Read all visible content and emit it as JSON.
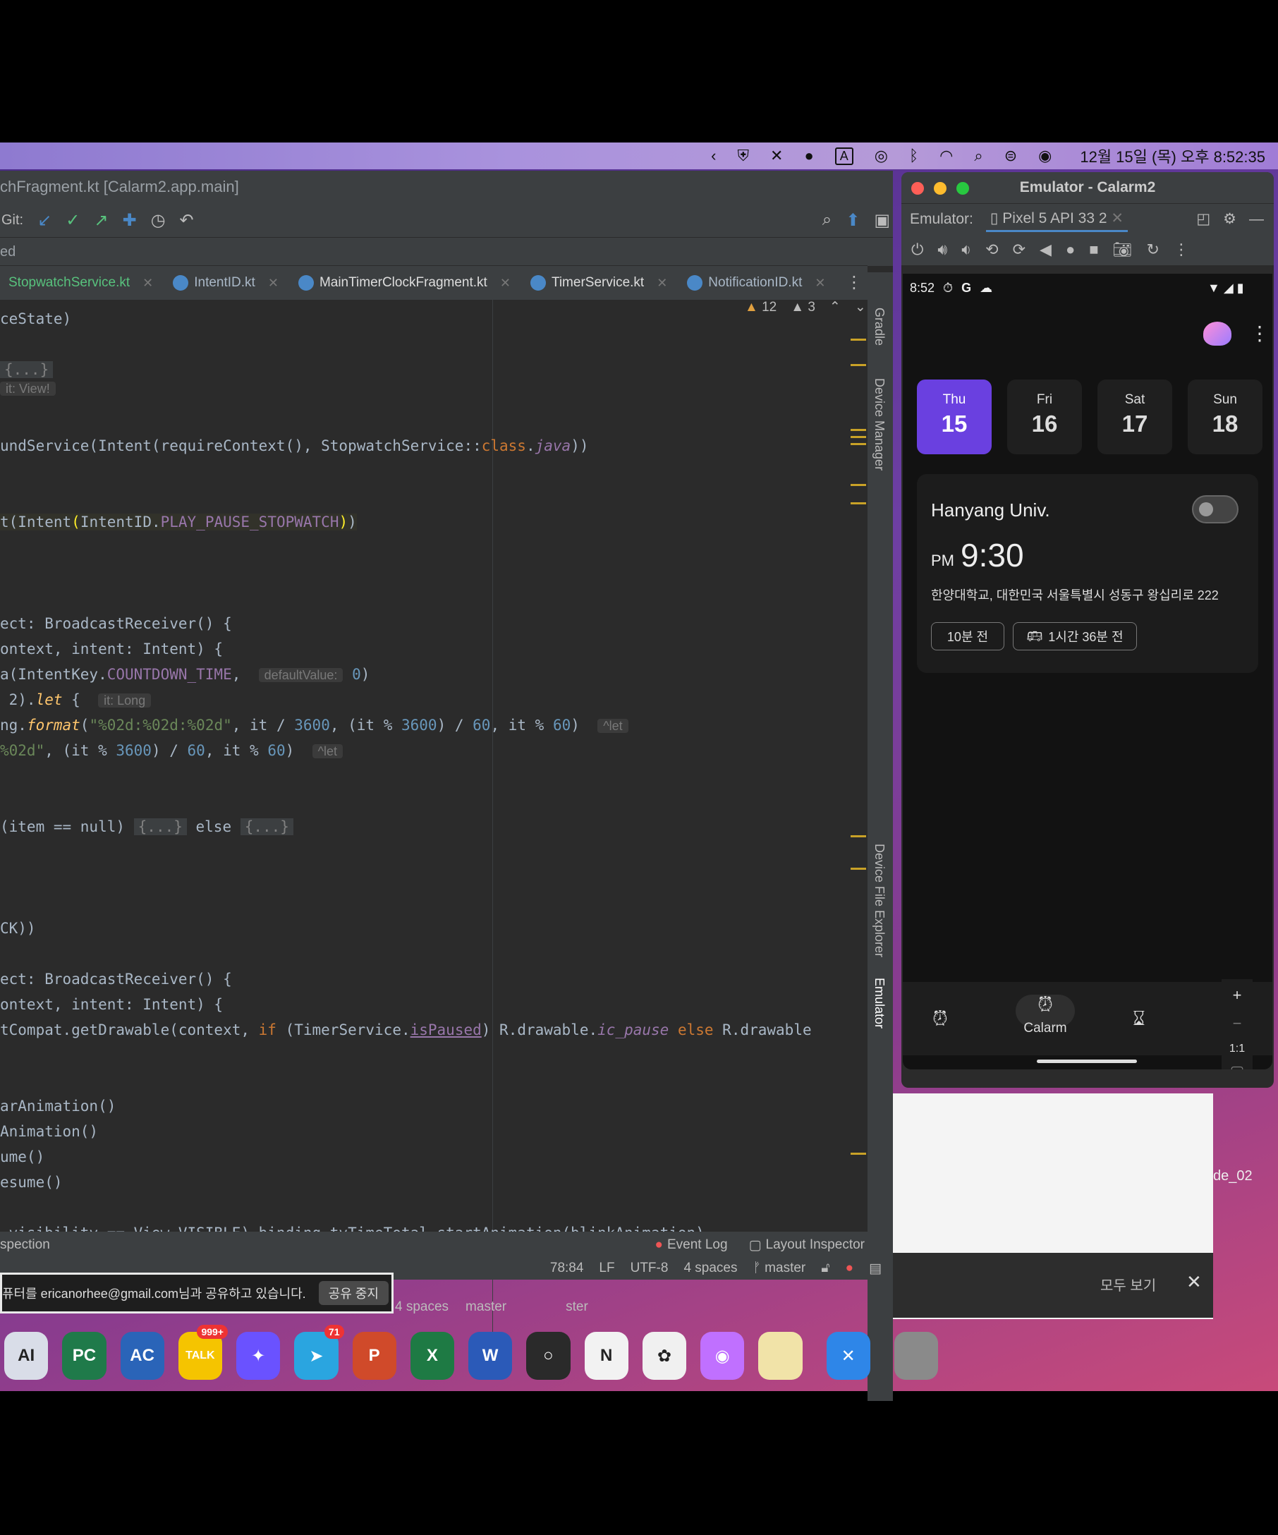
{
  "menubar": {
    "clock": "12월 15일 (목) 오후 8:52:35",
    "icons": [
      "chevron-left-icon",
      "shield-icon",
      "mute-icon",
      "messenger-icon",
      "input-a-icon",
      "airdrop-icon",
      "bluetooth-icon",
      "wifi-icon",
      "search-icon",
      "control-center-icon",
      "siri-icon"
    ],
    "input_label": "A"
  },
  "ide": {
    "title": "chFragment.kt [Calarm2.app.main]",
    "git_label": "Git:",
    "crumb": "ed",
    "tabs": [
      {
        "label": "StopwatchService.kt"
      },
      {
        "label": "IntentID.kt"
      },
      {
        "label": "MainTimerClockFragment.kt"
      },
      {
        "label": "TimerService.kt"
      },
      {
        "label": "NotificationID.kt"
      }
    ],
    "inspect": {
      "warnings": "12",
      "weak": "3"
    },
    "right_tools": [
      "Gradle",
      "Device Manager",
      "Device File Explorer",
      "Emulator"
    ],
    "status_top": {
      "left": "spection",
      "event_log": "Event Log",
      "layout_inspector": "Layout Inspector"
    },
    "status": {
      "pos": "78:84",
      "lf": "LF",
      "enc": "UTF-8",
      "indent": "4 spaces",
      "branch": "master"
    },
    "lower_status": {
      "indent": "4 spaces",
      "branch": "master",
      "branch2": "ster"
    }
  },
  "share": {
    "text": "퓨터를 ericanorhee@gmail.com님과 공유하고 있습니다.",
    "button": "공유 중지"
  },
  "notification": {
    "see_all": "모두 보기",
    "close": "✕",
    "file": "de_02"
  },
  "emulator": {
    "title": "Emulator - Calarm2",
    "tab_prefix": "Emulator:",
    "device": "Pixel 5 API 33 2",
    "phone": {
      "time": "8:52",
      "g": "G",
      "days": [
        {
          "name": "Thu",
          "num": "15",
          "selected": true
        },
        {
          "name": "Fri",
          "num": "16"
        },
        {
          "name": "Sat",
          "num": "17"
        },
        {
          "name": "Sun",
          "num": "18"
        }
      ],
      "card": {
        "title": "Hanyang Univ.",
        "ampm": "PM",
        "time": "9:30",
        "address": "한양대학교, 대한민국 서울특별시 성동구 왕십리로 222",
        "chip1": "10분 전",
        "chip2": "1시간 36분 전",
        "enabled": false
      },
      "nav": [
        {
          "label": "",
          "icon": "alarm-icon"
        },
        {
          "label": "Calarm",
          "icon": "alarm-icon"
        },
        {
          "label": "",
          "icon": "hourglass-icon"
        }
      ],
      "zoom": {
        "plus": "+",
        "minus": "−",
        "ratio": "1:1"
      }
    }
  },
  "dock": [
    {
      "label": "AI",
      "color": "#d9dde8"
    },
    {
      "label": "PC",
      "color": "#1f7a4a"
    },
    {
      "label": "AC",
      "color": "#2a64b8"
    },
    {
      "label": "TALK",
      "color": "#f5c400",
      "badge": "999+"
    },
    {
      "label": "✦",
      "color": "#6a52ff"
    },
    {
      "label": "➤",
      "color": "#2aa5e0",
      "badge": "71"
    },
    {
      "label": "P",
      "color": "#d04a2a"
    },
    {
      "label": "X",
      "color": "#1e7a44"
    },
    {
      "label": "W",
      "color": "#2b5ab8"
    },
    {
      "label": "○",
      "color": "#2a2a2a"
    },
    {
      "label": "N",
      "color": "#f2f2f2"
    },
    {
      "label": "✿",
      "color": "#f0f0f0"
    },
    {
      "label": "◉",
      "color": "#c070ff"
    },
    {
      "label": "",
      "color": "#f1e3a8"
    },
    {
      "label": "✕",
      "color": "#2e86e8"
    },
    {
      "label": "",
      "color": "#8a8a8a"
    }
  ]
}
